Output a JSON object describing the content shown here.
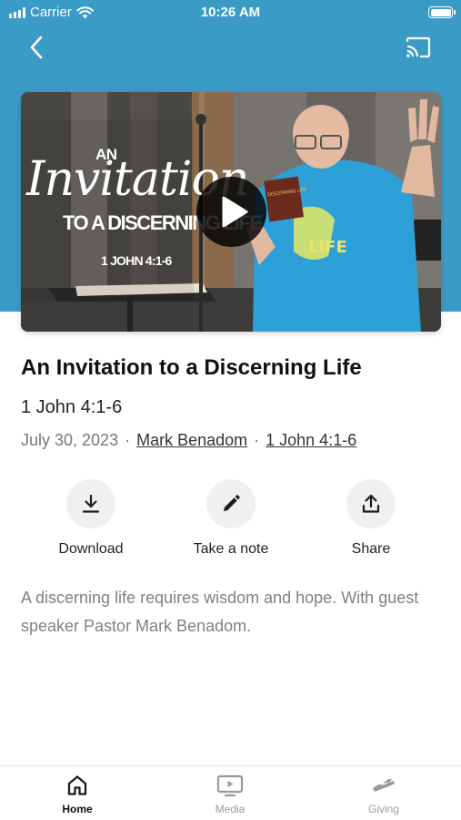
{
  "status_bar": {
    "carrier": "Carrier",
    "time": "10:26 AM"
  },
  "header": {
    "back_icon": "chevron-left-icon",
    "cast_icon": "cast-icon",
    "background_color": "#3a9bc7"
  },
  "video": {
    "overlay_an": "AN",
    "overlay_invitation": "Invitation",
    "overlay_discerning": "TO A DISCERNING LIFE",
    "overlay_reference": "1 JOHN 4:1-6",
    "book_title": "DISCERNING LIFE",
    "shirt_text": "LIFE",
    "play_icon": "play-icon"
  },
  "sermon": {
    "title": "An Invitation to a Discerning Life",
    "scripture": "1 John 4:1-6",
    "date": "July 30, 2023",
    "speaker": "Mark Benadom",
    "scripture_link": "1 John 4:1-6",
    "description": "A discerning life requires wisdom and hope. With guest speaker Pastor Mark Benadom."
  },
  "actions": [
    {
      "label": "Download",
      "icon": "download-icon"
    },
    {
      "label": "Take a note",
      "icon": "pencil-icon"
    },
    {
      "label": "Share",
      "icon": "share-icon"
    }
  ],
  "tabs": [
    {
      "label": "Home",
      "icon": "home-icon",
      "active": true
    },
    {
      "label": "Media",
      "icon": "media-icon",
      "active": false
    },
    {
      "label": "Giving",
      "icon": "giving-icon",
      "active": false
    }
  ]
}
